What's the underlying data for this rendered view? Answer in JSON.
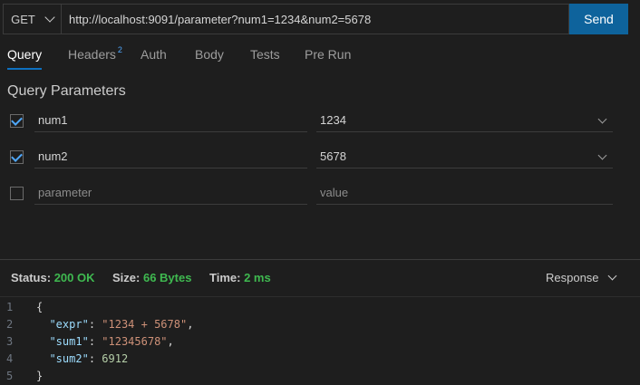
{
  "request": {
    "method": "GET",
    "url": "http://localhost:9091/parameter?num1=1234&num2=5678",
    "send_label": "Send"
  },
  "tabs": [
    {
      "label": "Query",
      "active": true
    },
    {
      "label": "Headers",
      "badge": "2"
    },
    {
      "label": "Auth"
    },
    {
      "label": "Body"
    },
    {
      "label": "Tests"
    },
    {
      "label": "Pre Run"
    }
  ],
  "query_section_title": "Query Parameters",
  "params": [
    {
      "checked": true,
      "name": "num1",
      "value": "1234"
    },
    {
      "checked": true,
      "name": "num2",
      "value": "5678"
    },
    {
      "checked": false,
      "name_placeholder": "parameter",
      "value_placeholder": "value"
    }
  ],
  "status": {
    "status_label": "Status:",
    "status_value": "200 OK",
    "size_label": "Size:",
    "size_value": "66 Bytes",
    "time_label": "Time:",
    "time_value": "2 ms",
    "view_label": "Response"
  },
  "response_lines": [
    {
      "n": "1",
      "tokens": [
        {
          "t": "{",
          "c": "p"
        }
      ]
    },
    {
      "n": "2",
      "tokens": [
        {
          "t": "  ",
          "c": "p"
        },
        {
          "t": "\"expr\"",
          "c": "k"
        },
        {
          "t": ": ",
          "c": "p"
        },
        {
          "t": "\"1234 + 5678\"",
          "c": "s"
        },
        {
          "t": ",",
          "c": "p"
        }
      ]
    },
    {
      "n": "3",
      "tokens": [
        {
          "t": "  ",
          "c": "p"
        },
        {
          "t": "\"sum1\"",
          "c": "k"
        },
        {
          "t": ": ",
          "c": "p"
        },
        {
          "t": "\"12345678\"",
          "c": "s"
        },
        {
          "t": ",",
          "c": "p"
        }
      ]
    },
    {
      "n": "4",
      "tokens": [
        {
          "t": "  ",
          "c": "p"
        },
        {
          "t": "\"sum2\"",
          "c": "k"
        },
        {
          "t": ": ",
          "c": "p"
        },
        {
          "t": "6912",
          "c": "n"
        }
      ]
    },
    {
      "n": "5",
      "tokens": [
        {
          "t": "}",
          "c": "p"
        }
      ]
    }
  ],
  "colors": {
    "accent": "#0e639c",
    "success": "#3fb950",
    "background": "#1e1e1e"
  }
}
